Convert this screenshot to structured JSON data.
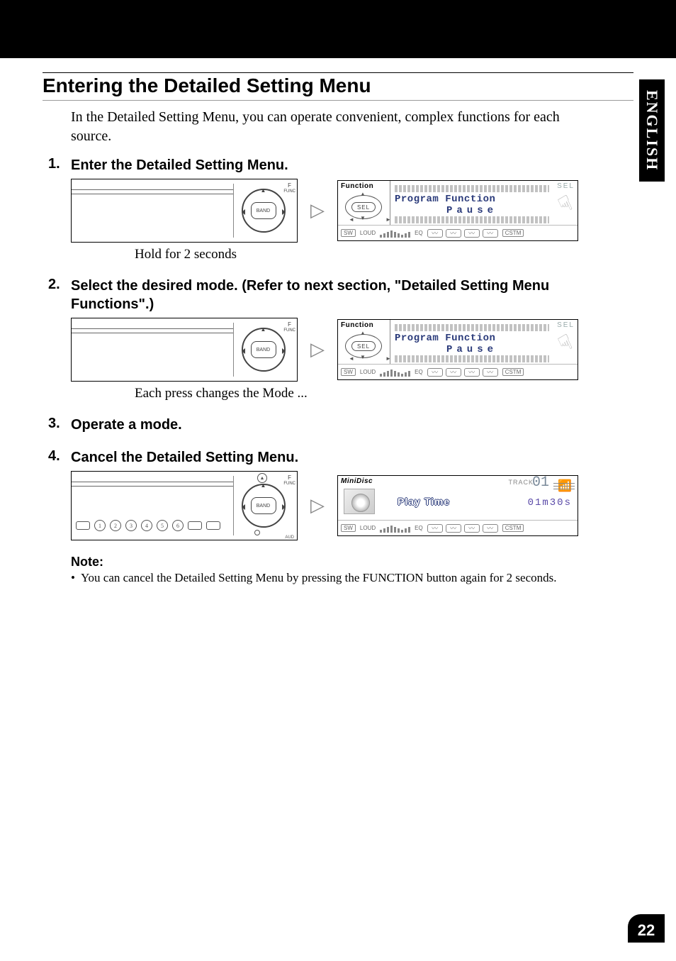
{
  "language_tab": "ENGLISH",
  "page_number": "22",
  "heading": "Entering the Detailed Setting Menu",
  "intro": "In the Detailed Setting Menu, you can operate convenient, complex functions for each source.",
  "steps": {
    "s1": {
      "num": "1.",
      "text": "Enter the Detailed Setting Menu."
    },
    "s2": {
      "num": "2.",
      "text": "Select the desired mode. (Refer to next section, \"Detailed Setting Menu Functions\".)"
    },
    "s3": {
      "num": "3.",
      "text": "Operate a mode."
    },
    "s4": {
      "num": "4.",
      "text": "Cancel the Detailed Setting Menu."
    }
  },
  "captions": {
    "c1": "Hold for 2 seconds",
    "c2": "Each press changes the Mode ..."
  },
  "device": {
    "dial_center": "BAND",
    "f_label": "F",
    "func_label": "FUNC",
    "aud_label": "AUD",
    "eject": "▲",
    "btn1": "1",
    "btn2": "2",
    "btn3": "3",
    "btn4": "4",
    "btn5": "5",
    "btn6": "6"
  },
  "display_func": {
    "top_left": "Function",
    "sel_pill": "SEL",
    "sel_right": "SEL",
    "line1": "Program Function",
    "line2": "Pause",
    "bottom": {
      "sw": "SW",
      "loud": "LOUD",
      "eq": "EQ",
      "cstm": "CSTM"
    }
  },
  "display_exit": {
    "top_left": "MiniDisc",
    "playtime_label": "Play Time",
    "track_label": "TRACK",
    "track_num": "01",
    "time": "01m30s",
    "bottom": {
      "sw": "SW",
      "loud": "LOUD",
      "eq": "EQ",
      "cstm": "CSTM"
    }
  },
  "note": {
    "heading": "Note:",
    "bullet": "•",
    "item1": "You can cancel the Detailed Setting Menu by pressing the FUNCTION button again for 2 seconds."
  }
}
